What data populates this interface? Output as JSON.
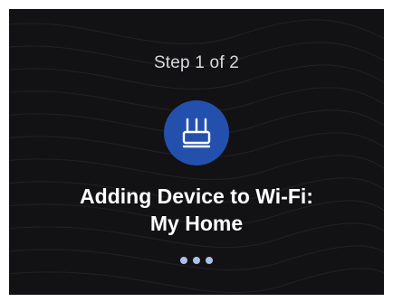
{
  "setup": {
    "step_text": "Step 1 of 2",
    "title_line1": "Adding Device to Wi-Fi:",
    "title_line2": "My Home",
    "icon": "router-icon"
  },
  "colors": {
    "background": "#121214",
    "accent": "#2450ad",
    "text": "#ffffff",
    "muted_text": "#d9d9de",
    "progress_dots": "#aac2ea"
  },
  "progress": {
    "state": "in-progress",
    "dot_count": 3
  }
}
